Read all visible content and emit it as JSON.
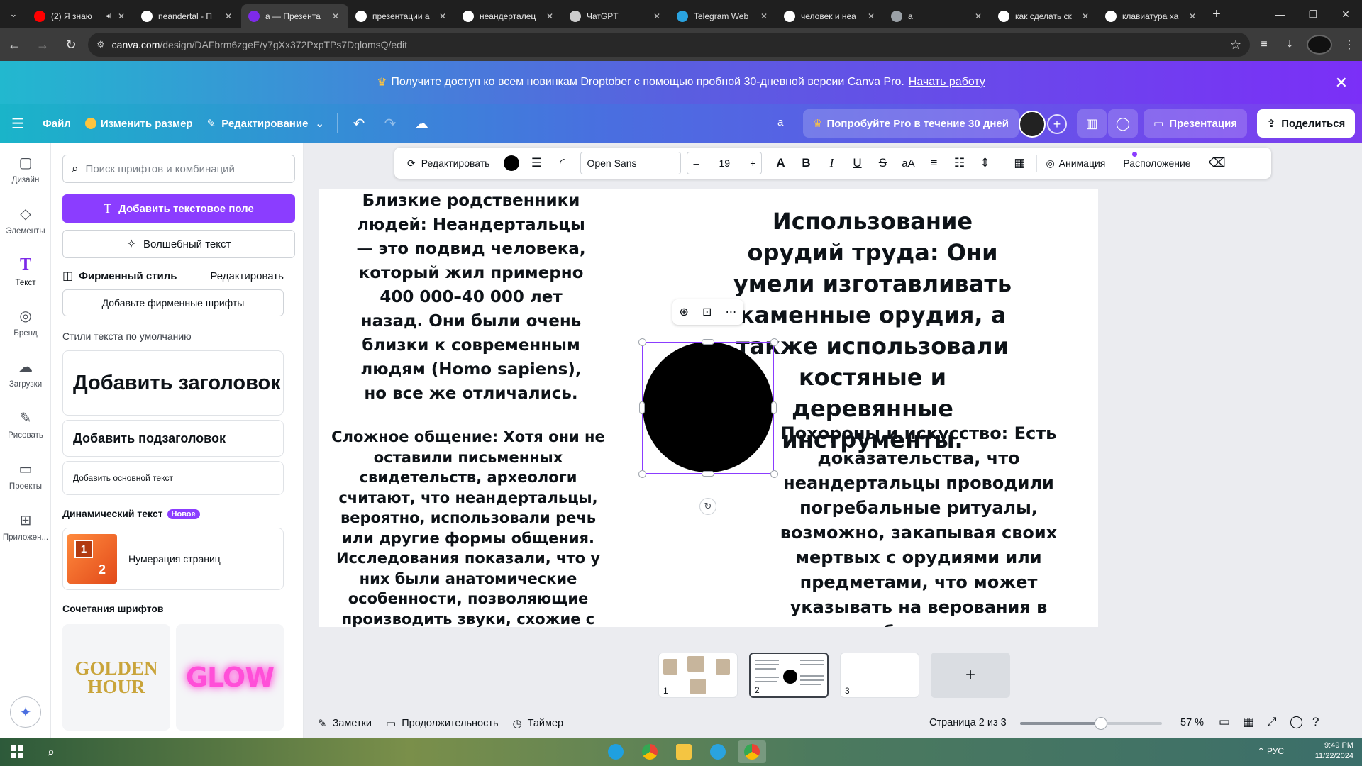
{
  "browser": {
    "tabs": [
      {
        "title": "(2) Я знаю",
        "favicon_color": "#ff0000",
        "audio": true,
        "active": false
      },
      {
        "title": "neandertal - П",
        "favicon_color": "#ffffff",
        "active": false
      },
      {
        "title": "а — Презента",
        "favicon_color": "#7d2ae8",
        "active": true
      },
      {
        "title": "презентации а",
        "favicon_color": "#ffffff",
        "active": false
      },
      {
        "title": "неандерталец",
        "favicon_color": "#ffffff",
        "active": false
      },
      {
        "title": "ЧатGPT",
        "favicon_color": "#cccccc",
        "active": false
      },
      {
        "title": "Telegram Web",
        "favicon_color": "#2aa3df",
        "active": false
      },
      {
        "title": "человек и неа",
        "favicon_color": "#ffffff",
        "active": false
      },
      {
        "title": "а",
        "favicon_color": "#9aa0a6",
        "active": false
      },
      {
        "title": "как сделать ск",
        "favicon_color": "#ffffff",
        "active": false
      },
      {
        "title": "клавиатура ха",
        "favicon_color": "#ffffff",
        "active": false
      }
    ],
    "url_host": "canva.com",
    "url_path": "/design/DAFbrm6zgeE/y7gXx372PxpTPs7DqlomsQ/edit"
  },
  "promo": {
    "text": "Получите доступ ко всем новинкам Droptober с помощью пробной 30-дневной версии Canva Pro.",
    "link": "Начать работу"
  },
  "header": {
    "file": "Файл",
    "resize": "Изменить размер",
    "editing": "Редактирование",
    "doc_title": "а",
    "try_pro": "Попробуйте Pro в течение 30 дней",
    "present": "Презентация",
    "share": "Поделиться"
  },
  "rail": [
    {
      "label": "Дизайн",
      "icon": "design-icon"
    },
    {
      "label": "Элементы",
      "icon": "elements-icon"
    },
    {
      "label": "Текст",
      "icon": "text-icon",
      "active": true
    },
    {
      "label": "Бренд",
      "icon": "brand-icon"
    },
    {
      "label": "Загрузки",
      "icon": "uploads-icon"
    },
    {
      "label": "Рисовать",
      "icon": "draw-icon"
    },
    {
      "label": "Проекты",
      "icon": "projects-icon"
    },
    {
      "label": "Приложен...",
      "icon": "apps-icon"
    }
  ],
  "panel": {
    "search_placeholder": "Поиск шрифтов и комбинаций",
    "add_textbox": "Добавить текстовое поле",
    "magic_text": "Волшебный текст",
    "brand_style": "Фирменный стиль",
    "brand_edit": "Редактировать",
    "add_brand_fonts": "Добавьте фирменные шрифты",
    "default_styles": "Стили текста по умолчанию",
    "add_heading": "Добавить заголовок",
    "add_subheading": "Добавить подзаголовок",
    "add_body": "Добавить основной текст",
    "dynamic_text": "Динамический текст",
    "new_badge": "Новое",
    "page_numbers": "Нумерация страниц",
    "thumb_n1": "1",
    "thumb_n2": "2",
    "font_combos": "Сочетания шрифтов",
    "combo1": "GOLDEN HOUR",
    "combo2": "GLOW"
  },
  "context_toolbar": {
    "edit": "Редактировать",
    "font": "Open Sans",
    "size": "19",
    "animation": "Анимация",
    "position": "Расположение"
  },
  "slide": {
    "top_left": "Близкие родственники людей: Неандертальцы — это подвид человека, который жил примерно 400 000–40 000 лет назад. Они были очень близки к современным людям (Homo sapiens), но все же отличались.",
    "bottom_left": "Сложное общение: Хотя они не оставили письменных свидетельств, археологи считают, что неандертальцы, вероятно, использовали речь или другие формы общения. Исследования показали, что у них были анатомические особенности, позволяющие производить звуки, схожие с человеческой речью.",
    "top_right": "Использование орудий труда: Они умели изготавливать каменные орудия, а также использовали костяные и деревянные инструменты.",
    "bottom_right": "Похороны и искусство: Есть доказательства, что неандертальцы проводили погребальные ритуалы, возможно, закапывая своих мертвых с орудиями или предметами, что может указывать на верования в загробную жизнь."
  },
  "pages": {
    "thumbs": [
      "1",
      "2",
      "3"
    ],
    "active": 2
  },
  "footer": {
    "notes": "Заметки",
    "duration": "Продолжительность",
    "timer": "Таймер",
    "page_indicator": "Страница 2 из 3",
    "zoom_percent": 57,
    "zoom_label": "57 %"
  },
  "taskbar": {
    "time": "9:49 PM",
    "date": "11/22/2024",
    "lang": "РУС"
  },
  "colors": {
    "accent": "#8b3dff",
    "selection": "#8b3dff"
  }
}
